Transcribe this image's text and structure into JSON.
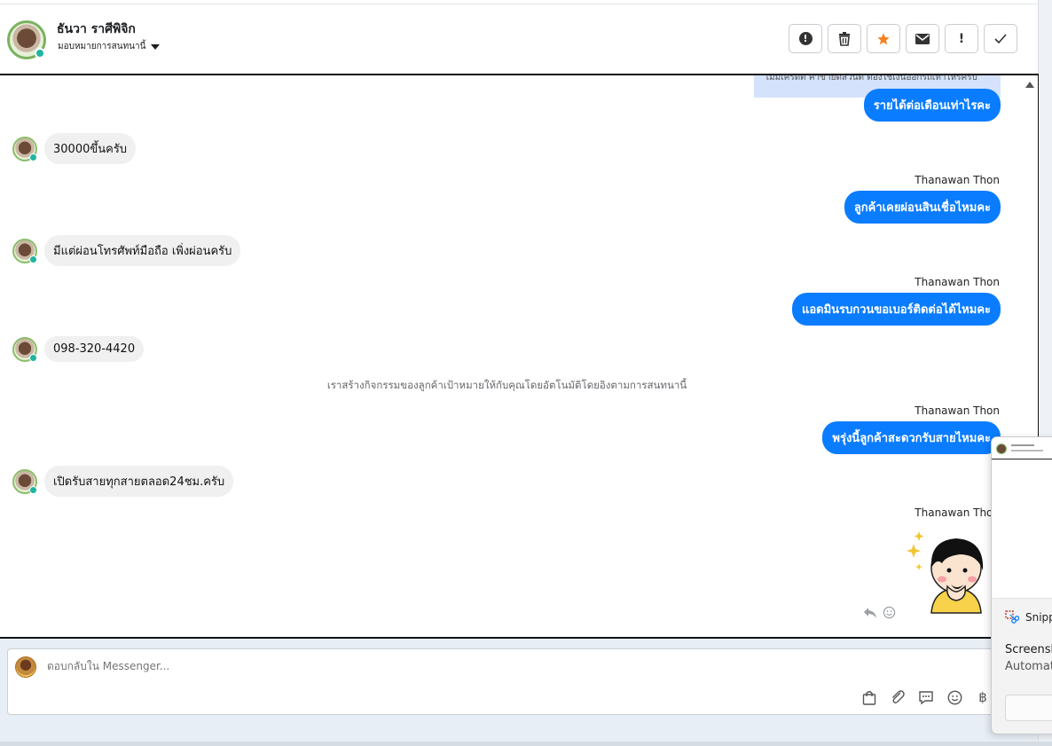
{
  "header": {
    "contact_name": "ธันวา ราศีพิจิก",
    "assign_label": "มอบหมายการสนทนานี้",
    "toolbar": [
      {
        "name": "report-spam-button",
        "icon": "alert-circle-icon"
      },
      {
        "name": "delete-button",
        "icon": "trash-icon"
      },
      {
        "name": "star-button",
        "icon": "star-icon"
      },
      {
        "name": "mark-unread-button",
        "icon": "envelope-icon"
      },
      {
        "name": "follow-up-button",
        "icon": "exclamation-icon",
        "label": "!"
      },
      {
        "name": "mark-done-button",
        "icon": "checkmark-icon"
      }
    ]
  },
  "chat": {
    "partial_top_text": "ไม่มีเครดิต ค่าขายดีส่วนต์ ต้องใช้เงินออกรถเท่าไหร่ครับ",
    "messages": [
      {
        "dir": "out",
        "sender": "",
        "text": "รายได้ต่อเดือนเท่าไรคะ"
      },
      {
        "dir": "in",
        "text": "30000ขึ้นครับ"
      },
      {
        "dir": "out",
        "sender": "Thanawan Thon",
        "text": "ลูกค้าเคยผ่อนสินเชื่อไหมคะ"
      },
      {
        "dir": "in",
        "text": "มีแต่ผ่อนโทรศัพท์มือถือ เพิ่งผ่อนครับ"
      },
      {
        "dir": "out",
        "sender": "Thanawan Thon",
        "text": "แอดมินรบกวนขอเบอร์ติดต่อได้ไหมคะ"
      },
      {
        "dir": "in",
        "text": "098-320-4420"
      },
      {
        "dir": "out",
        "sender": "Thanawan Thon",
        "text": "พรุ่งนี้ลูกค้าสะดวกรับสายไหมคะ"
      },
      {
        "dir": "in",
        "text": "เปิดรับสายทุกสายตลอด24ชม.ครับ"
      },
      {
        "dir": "out",
        "sender": "Thanawan Thon",
        "text": ""
      }
    ],
    "system_note": "เราสร้างกิจกรรมของลูกค้าเป้าหมายให้กับคุณโดยอัตโนมัติโดยอิงตามการสนทนานี้"
  },
  "composer": {
    "placeholder": "ตอบกลับใน Messenger...",
    "tools": [
      "shopping-bag-icon",
      "paperclip-icon",
      "saved-reply-icon",
      "emoji-icon",
      "baht-icon"
    ],
    "baht_glyph": "฿"
  },
  "notification": {
    "app_name": "Snipp",
    "title": "Screensh",
    "subtitle": "Automat"
  },
  "colors": {
    "outgoing_bubble": "#0a7cff",
    "incoming_bubble": "#f0f0f0",
    "star_active": "#f5821f"
  }
}
